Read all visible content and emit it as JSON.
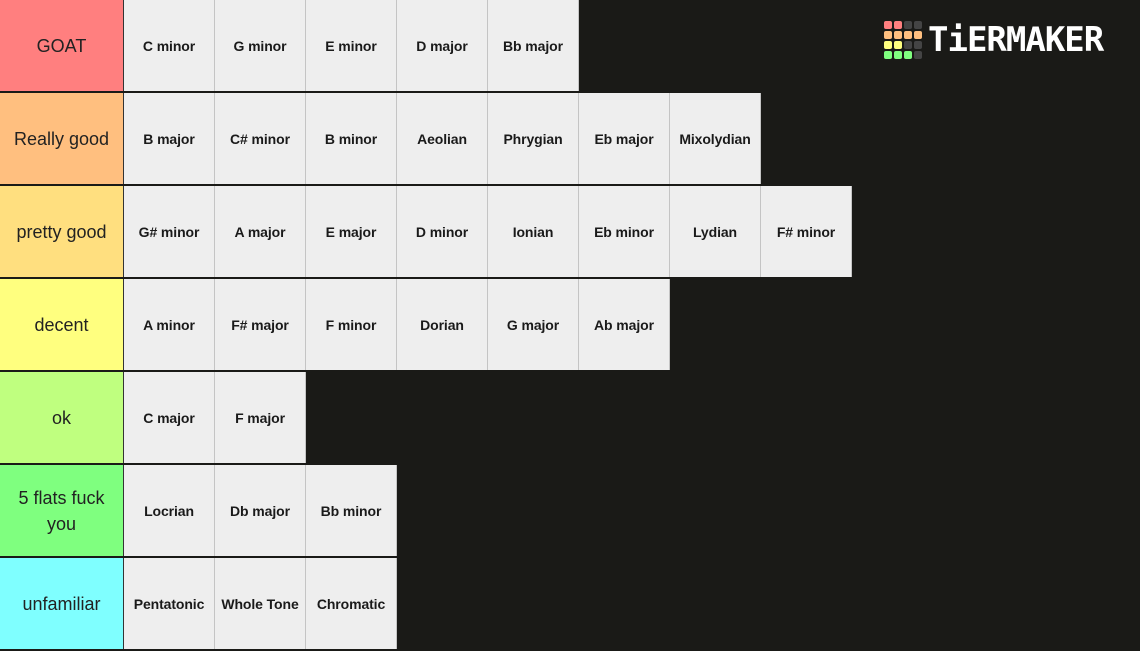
{
  "logo": {
    "text": "TiERMAKER",
    "grid_colors": [
      "#ff7f7f",
      "#ff7f7f",
      "#444444",
      "#444444",
      "#ffbf7f",
      "#ffbf7f",
      "#ffbf7f",
      "#ffbf7f",
      "#ffff7f",
      "#ffff7f",
      "#444444",
      "#444444",
      "#7fff7f",
      "#7fff7f",
      "#7fff7f",
      "#444444"
    ]
  },
  "tiers": [
    {
      "label": "GOAT",
      "color": "#ff7f7f",
      "items": [
        "C minor",
        "G minor",
        "E minor",
        "D major",
        "Bb major"
      ]
    },
    {
      "label": "Really good",
      "color": "#ffbf7f",
      "items": [
        "B major",
        "C# minor",
        "B minor",
        "Aeolian",
        "Phrygian",
        "Eb major",
        "Mixolydian"
      ]
    },
    {
      "label": "pretty good",
      "color": "#ffdf7f",
      "items": [
        "G# minor",
        "A major",
        "E major",
        "D minor",
        "Ionian",
        "Eb minor",
        "Lydian",
        "F# minor"
      ]
    },
    {
      "label": "decent",
      "color": "#ffff7f",
      "items": [
        "A minor",
        "F# major",
        "F minor",
        "Dorian",
        "G major",
        "Ab major"
      ]
    },
    {
      "label": "ok",
      "color": "#bfff7f",
      "items": [
        "C major",
        "F major"
      ]
    },
    {
      "label": "5 flats fuck you",
      "color": "#7fff7f",
      "items": [
        "Locrian",
        "Db major",
        "Bb minor"
      ]
    },
    {
      "label": "unfamiliar",
      "color": "#7fffff",
      "items": [
        "Pentatonic",
        "Whole Tone",
        "Chromatic"
      ]
    }
  ]
}
